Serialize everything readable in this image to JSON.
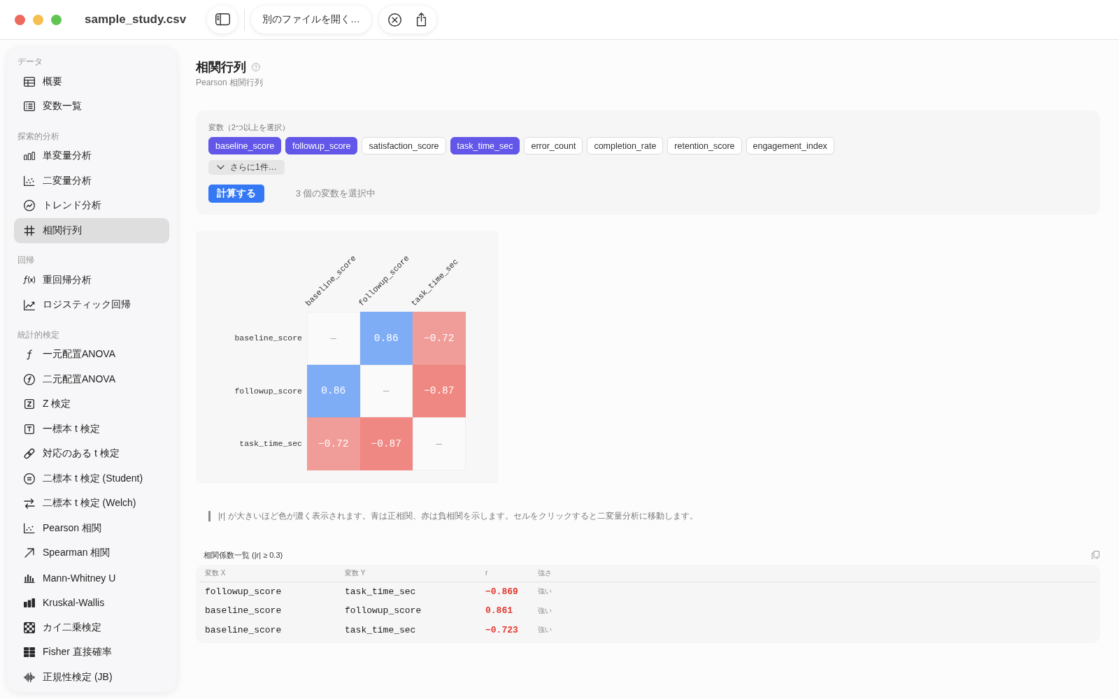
{
  "window": {
    "title": "sample_study.csv"
  },
  "toolbar": {
    "open_file_button": "別のファイルを開く…"
  },
  "sidebar": {
    "sections": [
      {
        "label": "データ",
        "items": [
          {
            "label": "概要",
            "selected": false
          },
          {
            "label": "変数一覧",
            "selected": false
          }
        ]
      },
      {
        "label": "探索的分析",
        "items": [
          {
            "label": "単変量分析",
            "selected": false
          },
          {
            "label": "二変量分析",
            "selected": false
          },
          {
            "label": "トレンド分析",
            "selected": false
          },
          {
            "label": "相関行列",
            "selected": true
          }
        ]
      },
      {
        "label": "回帰",
        "items": [
          {
            "label": "重回帰分析",
            "selected": false
          },
          {
            "label": "ロジスティック回帰",
            "selected": false
          }
        ]
      },
      {
        "label": "統計的検定",
        "items": [
          {
            "label": "一元配置ANOVA",
            "selected": false
          },
          {
            "label": "二元配置ANOVA",
            "selected": false
          },
          {
            "label": "Z 検定",
            "selected": false
          },
          {
            "label": "一標本 t 検定",
            "selected": false
          },
          {
            "label": "対応のある t 検定",
            "selected": false
          },
          {
            "label": "二標本 t 検定 (Student)",
            "selected": false
          },
          {
            "label": "二標本 t 検定 (Welch)",
            "selected": false
          },
          {
            "label": "Pearson 相関",
            "selected": false
          },
          {
            "label": "Spearman 相関",
            "selected": false
          },
          {
            "label": "Mann-Whitney U",
            "selected": false
          },
          {
            "label": "Kruskal-Wallis",
            "selected": false
          },
          {
            "label": "カイ二乗検定",
            "selected": false
          },
          {
            "label": "Fisher 直接確率",
            "selected": false
          },
          {
            "label": "正規性検定 (JB)",
            "selected": false
          }
        ]
      }
    ]
  },
  "page": {
    "title": "相関行列",
    "subtitle": "Pearson 相関行列"
  },
  "variables": {
    "label": "変数（2つ以上を選択）",
    "chips": [
      {
        "label": "baseline_score",
        "selected": true
      },
      {
        "label": "followup_score",
        "selected": true
      },
      {
        "label": "satisfaction_score",
        "selected": false
      },
      {
        "label": "task_time_sec",
        "selected": true
      },
      {
        "label": "error_count",
        "selected": false
      },
      {
        "label": "completion_rate",
        "selected": false
      },
      {
        "label": "retention_score",
        "selected": false
      },
      {
        "label": "engagement_index",
        "selected": false
      }
    ],
    "more_button": "さらに1件…",
    "compute_button": "計算する",
    "selection_status": "3 個の変数を選択中"
  },
  "heatmap": {
    "columns": [
      "baseline_score",
      "followup_score",
      "task_time_sec"
    ],
    "rows": [
      {
        "label": "baseline_score",
        "cells": [
          {
            "kind": "diagonal",
            "text": "—"
          },
          {
            "kind": "value",
            "text": "0.86",
            "color": "#7eadf6"
          },
          {
            "kind": "value",
            "text": "−0.72",
            "color": "#f09c98"
          }
        ]
      },
      {
        "label": "followup_score",
        "cells": [
          {
            "kind": "value",
            "text": "0.86",
            "color": "#7eadf6"
          },
          {
            "kind": "diagonal",
            "text": "—"
          },
          {
            "kind": "value",
            "text": "−0.87",
            "color": "#ef8782"
          }
        ]
      },
      {
        "label": "task_time_sec",
        "cells": [
          {
            "kind": "value",
            "text": "−0.72",
            "color": "#f09c98"
          },
          {
            "kind": "value",
            "text": "−0.87",
            "color": "#ef8782"
          },
          {
            "kind": "diagonal",
            "text": "—"
          }
        ]
      }
    ]
  },
  "note": "|r| が大きいほど色が濃く表示されます。青は正相関、赤は負相関を示します。セルをクリックすると二変量分析に移動します。",
  "table": {
    "title": "相関係数一覧 (|r| ≥ 0.3)",
    "columns": [
      "変数 X",
      "変数 Y",
      "r",
      "強さ"
    ],
    "rows": [
      {
        "variable_x": "followup_score",
        "variable_y": "task_time_sec",
        "r": "−0.869",
        "strength": "強い"
      },
      {
        "variable_x": "baseline_score",
        "variable_y": "followup_score",
        "r": "0.861",
        "strength": "強い"
      },
      {
        "variable_x": "baseline_score",
        "variable_y": "task_time_sec",
        "r": "−0.723",
        "strength": "強い"
      }
    ]
  }
}
